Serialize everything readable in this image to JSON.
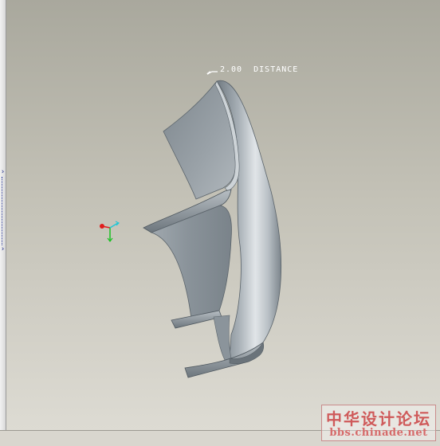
{
  "viewport": {
    "dimension_value": "2.00",
    "dimension_type": "DISTANCE"
  },
  "triad": {
    "x_color": "#e11d1d",
    "y_color": "#18c020",
    "z_color": "#22c6d6"
  },
  "left_strip": {
    "arrow_top": "›",
    "arrow_bottom": "›"
  },
  "watermark": {
    "title": "中华设计论坛",
    "url": "bbs.chinade.net"
  },
  "colors": {
    "part_base": "#8e979e",
    "part_highlight": "#e3e7ea",
    "part_shadow": "#4d565d",
    "background_top": "#a9a89d",
    "background_bottom": "#dddbd3"
  }
}
